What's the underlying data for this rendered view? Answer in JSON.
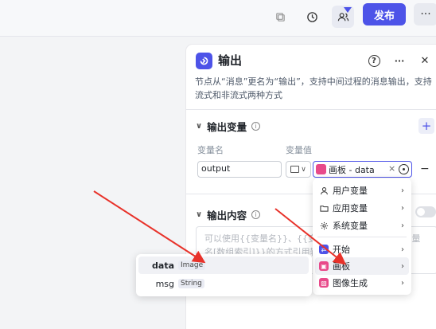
{
  "toolbar": {
    "publish_label": "发布",
    "more_label": "···",
    "accent": "#4d53e8"
  },
  "node": {
    "title": "输出",
    "description": "节点从“消息”更名为“输出”，支持中间过程的消息输出，支持流式和非流式两种方式",
    "help_label": "?",
    "more_label": "···",
    "close_label": "✕"
  },
  "output_vars": {
    "title": "输出变量",
    "add_label": "+",
    "col_name": "变量名",
    "col_value": "变量值",
    "rows": [
      {
        "name": "output",
        "value": "画板 - data",
        "remove_label": "−"
      }
    ]
  },
  "output_content": {
    "title": "输出内容",
    "placeholder": "可以使用{{变量名}}、{{变量名.子变量名}}、{{变量名[数组索引]}}的方式引用输出参数中的变量"
  },
  "var_menu": {
    "items": [
      {
        "label": "用户变量",
        "icon": "user-icon"
      },
      {
        "label": "应用变量",
        "icon": "folder-icon"
      },
      {
        "label": "系统变量",
        "icon": "gear-icon"
      },
      {
        "label": "开始",
        "icon": "start-node-icon"
      },
      {
        "label": "画板",
        "icon": "canvas-node-icon"
      },
      {
        "label": "图像生成",
        "icon": "image-gen-icon"
      }
    ]
  },
  "sub_menu": {
    "items": [
      {
        "name": "data",
        "type": "Image"
      },
      {
        "name": "msg",
        "type": "String"
      }
    ]
  },
  "colors": {
    "start_node": "#4d53e8",
    "canvas_node": "#e84a8a",
    "image_gen_node": "#e84a8a",
    "annotation_arrow": "#e8322a"
  }
}
